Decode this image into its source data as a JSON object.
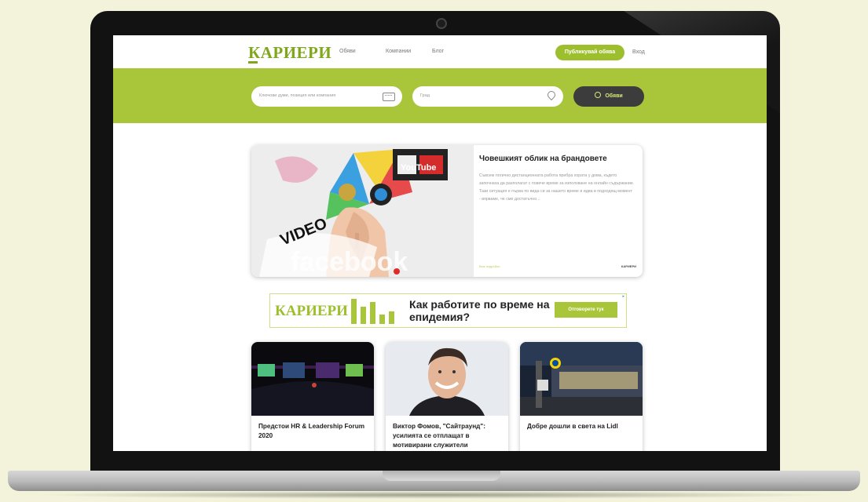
{
  "header": {
    "logo": "КАРИЕРИ",
    "nav": [
      "Обяви",
      "Компании",
      "Блог"
    ],
    "publish_button": "Публикувай обява",
    "login": "Вход"
  },
  "search": {
    "keywords_placeholder": "Ключови думи, позиция или компания",
    "city_placeholder": "Град",
    "button": "Обяви"
  },
  "featured": {
    "title": "Човешкият облик на брандовете",
    "excerpt": "Съвсем логично дистанционната работа прибра хората у дома, където започнаха да разполагат с повече време за използване на онлайн съдържание. Тази ситуация е първа по вида си за нашето време и идва в подходящ момент - вярваме, че сме достатъчно...",
    "meta": "Виж подробно",
    "source": "КАРИЕРИ",
    "image_words": [
      "VIDEO",
      "YouTube",
      "facebook"
    ]
  },
  "banner": {
    "logo": "КАРИЕРИ",
    "question": "Как работите по време на епидемия?",
    "button": "Отговорете тук"
  },
  "cards": [
    {
      "title": "Предстои HR & Leadership Forum 2020"
    },
    {
      "title": "Виктор Фомов, \"Сайтраунд\": усилията се отплащат в мотивирани служители"
    },
    {
      "title": "Добре дошли в света на Lidl"
    }
  ],
  "colors": {
    "brand_green": "#a9c63b",
    "logo_green": "#7fa61c",
    "dark_button": "#3c3c3c"
  }
}
